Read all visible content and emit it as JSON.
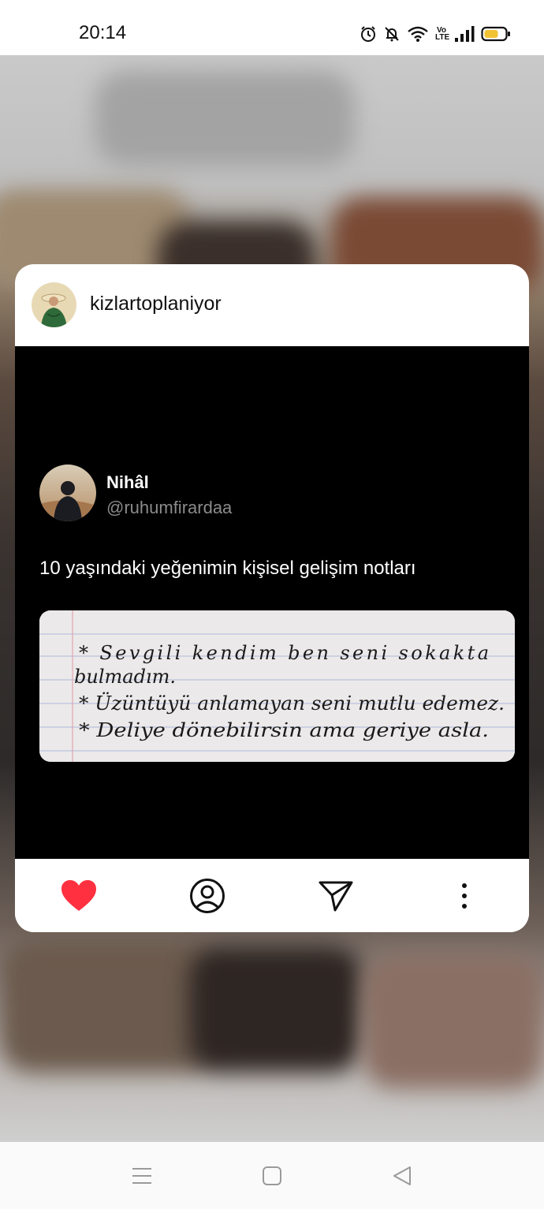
{
  "status_bar": {
    "time": "20:14",
    "icons": [
      "alarm-icon",
      "bell-off-icon",
      "wifi-icon",
      "volte-icon",
      "signal-icon",
      "battery-icon"
    ],
    "volte_label_top": "Vo",
    "volte_label_bottom": "LTE"
  },
  "card": {
    "username": "kizlartoplaniyor",
    "post": {
      "author_name": "Nihâl",
      "author_handle": "@ruhumfirardaa",
      "text": "10 yaşındaki yeğenimin kişisel gelişim notları",
      "note_lines": [
        "* Sevgili kendim ben seni sokakta",
        "bulmadım.",
        "* Üzüntüyü anlamayan seni mutlu edemez.",
        "* Deliye dönebilirsin ama geriye asla."
      ]
    },
    "actions": [
      "heart-icon",
      "profile-icon",
      "send-icon",
      "more-vertical-icon"
    ]
  },
  "colors": {
    "heart": "#ff3040",
    "card_bg": "#ffffff",
    "post_bg": "#000000",
    "handle": "#8b8b8b"
  },
  "nav_bar": {
    "buttons": [
      "menu-icon",
      "home-square-icon",
      "back-triangle-icon"
    ]
  }
}
